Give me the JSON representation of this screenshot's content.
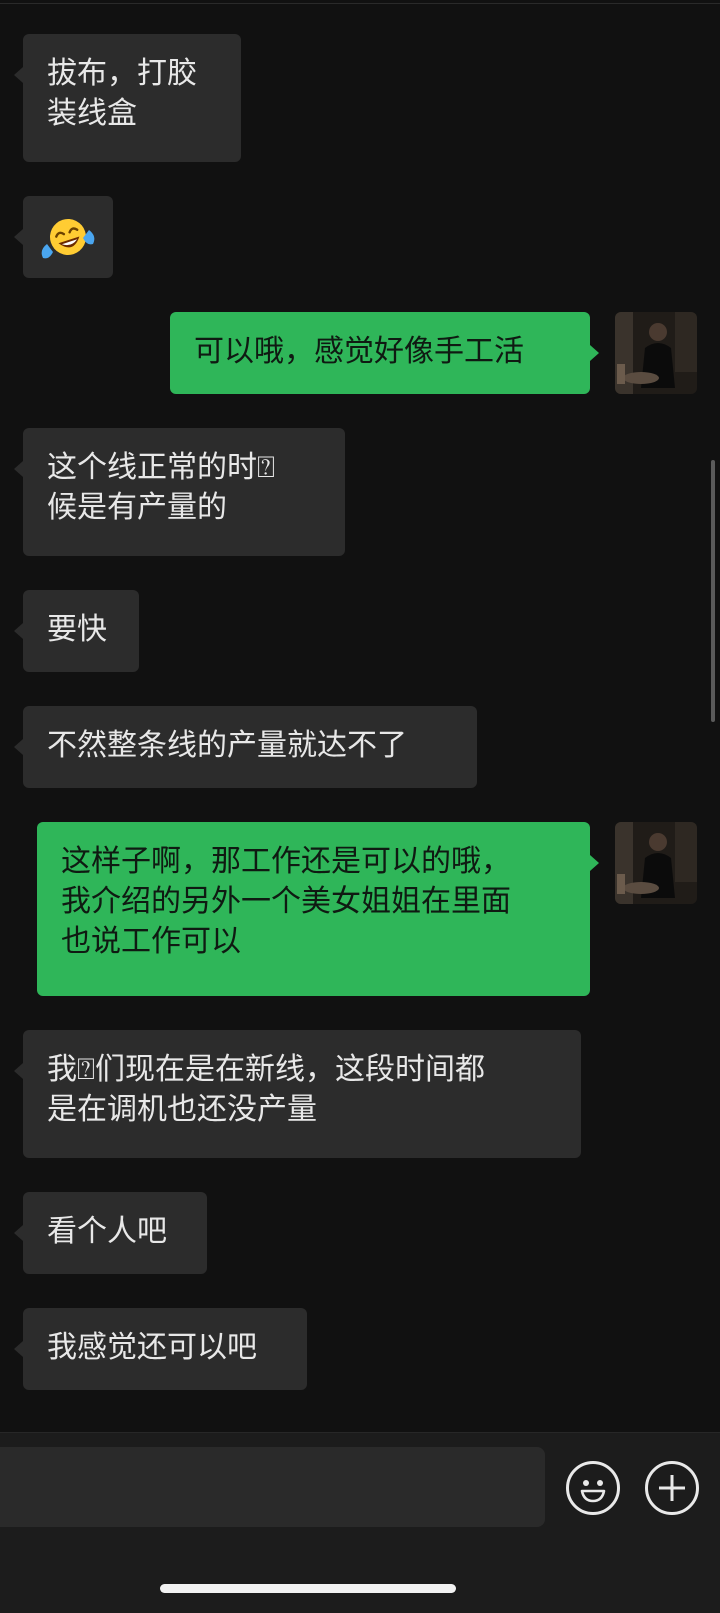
{
  "colors": {
    "background": "#111111",
    "incoming_bubble": "#2c2c2c",
    "outgoing_bubble": "#2fb659"
  },
  "messages": [
    {
      "side": "in",
      "lines": [
        "拔布，打胶",
        "装线盒"
      ]
    },
    {
      "side": "in",
      "emoji": "crying-laughing-face"
    },
    {
      "side": "out",
      "lines": [
        "可以哦，感觉好像手工活"
      ]
    },
    {
      "side": "in",
      "lines": [
        "这个线正常的时⍰",
        "候是有产量的"
      ]
    },
    {
      "side": "in",
      "lines": [
        "要快"
      ]
    },
    {
      "side": "in",
      "lines": [
        "不然整条线的产量就达不了"
      ]
    },
    {
      "side": "out",
      "lines": [
        "这样子啊，那工作还是可以的哦，",
        "我介绍的另外一个美女姐姐在里面",
        "也说工作可以"
      ]
    },
    {
      "side": "in",
      "lines": [
        "我⍰们现在是在新线，这段时间都",
        "是在调机也还没产量"
      ]
    },
    {
      "side": "in",
      "lines": [
        "看个人吧"
      ]
    },
    {
      "side": "in",
      "lines": [
        "我感觉还可以吧"
      ]
    }
  ],
  "input": {
    "value": "",
    "emoji_button_icon": "smiley-face-icon",
    "more_button_icon": "plus-icon"
  }
}
